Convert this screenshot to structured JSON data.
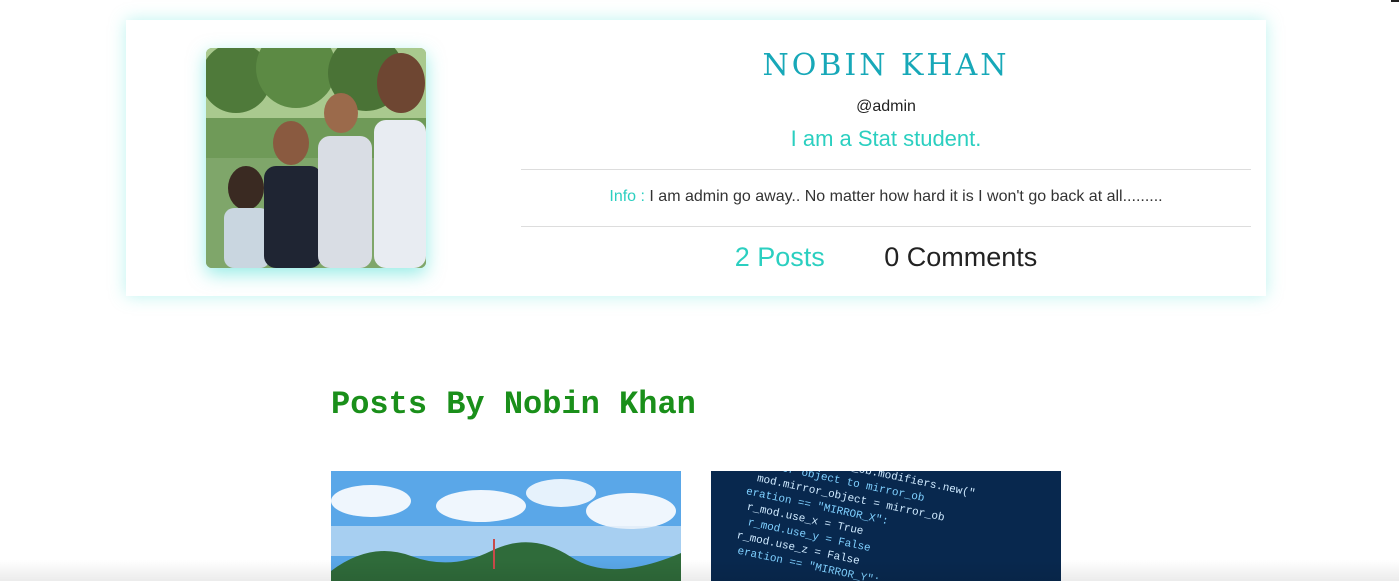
{
  "profile": {
    "name": "NOBIN KHAN",
    "username": "@admin",
    "tagline": "I am a Stat student.",
    "bio_label": "Info :",
    "bio_text": "I am admin go away.. No matter how hard it is I won't go back at all.........",
    "posts_count": "2 Posts",
    "comments_count": "0 Comments",
    "accent_color": "#2bcfc0",
    "name_color": "#17a8b8"
  },
  "posts_section": {
    "title": "Posts By Nobin Khan",
    "title_color": "#1a8f1a",
    "posts": [
      {
        "image": "landscape-sky-trees"
      },
      {
        "image": "code-screen"
      }
    ]
  },
  "code_thumbnail_lines": [
    "_mod = modifier_ob.modifiers.new(\"",
    "mirror object to mirror_ob",
    "mod.mirror_object = mirror_ob",
    "eration == \"MIRROR_X\":",
    "r_mod.use_x = True",
    "r_mod.use_y = False",
    "r_mod.use_z = False",
    "eration == \"MIRROR_Y\":"
  ]
}
